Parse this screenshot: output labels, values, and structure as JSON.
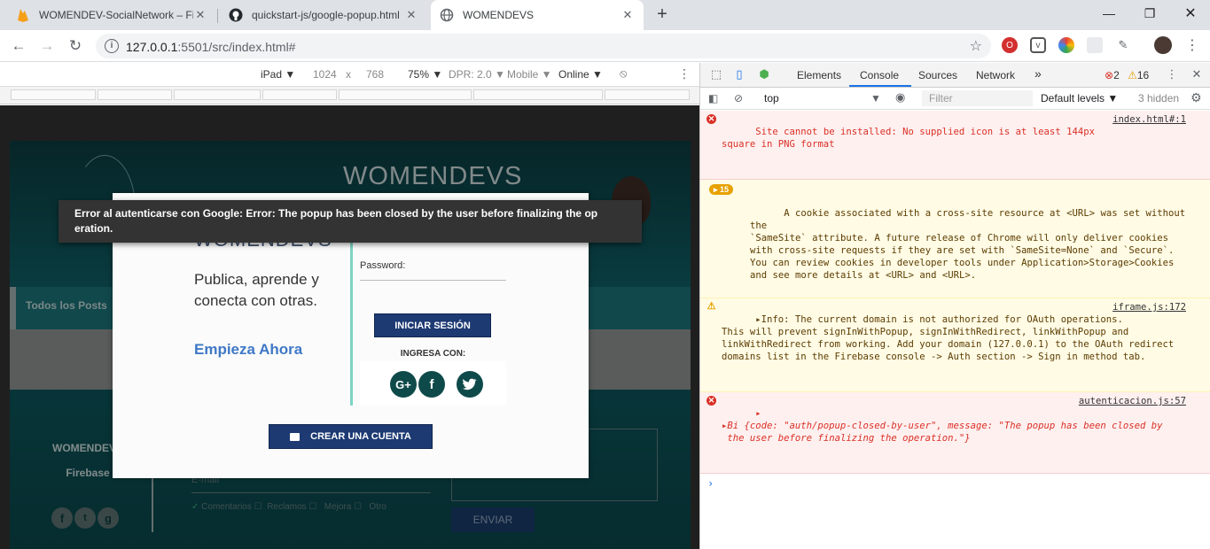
{
  "browser": {
    "tabs": [
      {
        "label": "WOMENDEV-SocialNetwork – Fir",
        "icon": "firebase-icon"
      },
      {
        "label": "quickstart-js/google-popup.html",
        "icon": "github-icon"
      },
      {
        "label": "WOMENDEVS",
        "icon": "globe-icon",
        "active": true
      }
    ],
    "new_tab": "+",
    "url_host": "127.0.0.1",
    "url_path": ":5501/src/index.html#"
  },
  "device_toolbar": {
    "device": "iPad ▼",
    "width": "1024",
    "times": "x",
    "height": "768",
    "zoom": "75% ▼",
    "dpr": "DPR: 2.0 ▼",
    "mode": "Mobile ▼",
    "network": "Online ▼"
  },
  "page": {
    "brand": "WOMENDEVS",
    "nav_link": "Todos los Posts",
    "footer_brand": "WOMENDEVS",
    "footer_firebase": "Firebase",
    "email_label": "E-mail",
    "checks": [
      "Comentarios",
      "Reclamos",
      "Mejora",
      "Otro"
    ],
    "send_button": "ENVIAR"
  },
  "modal": {
    "logo": "WOMENDEVS",
    "slogan": "Publica, aprende y conecta con otras.",
    "cta": "Empieza Ahora",
    "password_label": "Password:",
    "login_button": "INICIAR SESIÓN",
    "ingresa": "INGRESA CON:",
    "create_button": "CREAR UNA CUENTA"
  },
  "toast": {
    "text": "Error al autenticarse con Google: Error: The popup has been closed by the user before finalizing the op eration."
  },
  "devtools": {
    "tabs": [
      "Elements",
      "Console",
      "Sources",
      "Network"
    ],
    "more": "»",
    "error_count": "2",
    "warning_count": "16",
    "context": "top",
    "filter_placeholder": "Filter",
    "levels": "Default levels ▼",
    "hidden": "3 hidden",
    "messages": [
      {
        "level": "error",
        "text": "Site cannot be installed: No supplied icon is at least 144px\nsquare in PNG format",
        "source": "index.html#:1"
      },
      {
        "level": "warning",
        "count": "15",
        "text": "A cookie associated with a cross-site resource at <URL> was set without the\n`SameSite` attribute. A future release of Chrome will only deliver cookies\nwith cross-site requests if they are set with `SameSite=None` and `Secure`.\nYou can review cookies in developer tools under Application>Storage>Cookies\nand see more details at <URL> and <URL>."
      },
      {
        "level": "warning",
        "text": "▸Info: The current domain is not authorized for OAuth operations.\nThis will prevent signInWithPopup, signInWithRedirect, linkWithPopup and\nlinkWithRedirect from working. Add your domain (127.0.0.1) to the OAuth redirect\ndomains list in the Firebase console -> Auth section -> Sign in method tab.",
        "source": "iframe.js:172"
      },
      {
        "level": "error",
        "text": "▸\n▸Bi {code: \"auth/popup-closed-by-user\", message: \"The popup has been closed by\n the user before finalizing the operation.\"}",
        "source": "autenticacion.js:57"
      }
    ],
    "prompt": "›"
  },
  "colors": {
    "accent": "#1a73e8",
    "error": "#d93025",
    "warning": "#e8a100",
    "modal_button": "#1d3a73",
    "page_teal": "#0e5b61"
  }
}
